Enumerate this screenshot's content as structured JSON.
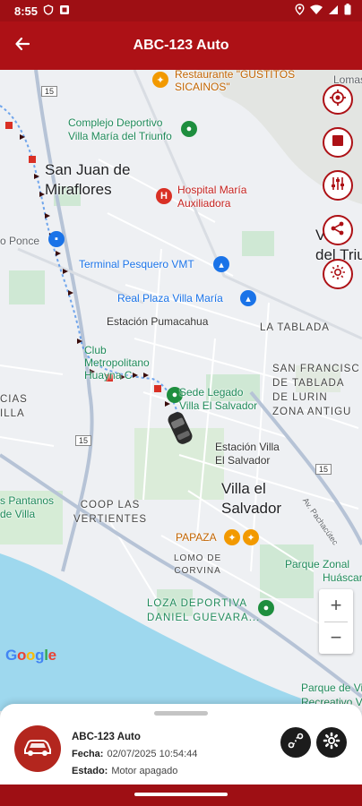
{
  "status_bar": {
    "time": "8:55"
  },
  "app_bar": {
    "title": "ABC-123 Auto"
  },
  "map": {
    "labels": {
      "restaurante_gustitos": "Restaurante \"GUSTITOS SICAINOS\"",
      "lomas": "Lomas",
      "complejo_deportivo": "Complejo Deportivo Villa María del Triunfo",
      "san_juan": "San Juan de Miraflores",
      "hospital": "Hospital María Auxiliadora",
      "villa_maria_triunfo_1": "V",
      "villa_maria_triunfo_2": "M",
      "villa_maria_triunfo_3": "del Triu",
      "ponce": "o Ponce",
      "terminal": "Terminal Pesquero VMT",
      "real_plaza": "Real Plaza Villa María",
      "estacion_pumacahua": "Estación Pumacahua",
      "la_tablada": "LA TABLADA",
      "club_1": "Club",
      "club_2": "Metropolitano",
      "club_3": "Huayna C",
      "san_francisco_1": "SAN FRANCISC",
      "san_francisco_2": "DE TABLADA",
      "san_francisco_3": "DE LURIN",
      "zona_antigua": "ZONA ANTIGU",
      "cias": "CIAS",
      "illa": "ILLA",
      "sede_legado_1": "Sede Legado",
      "sede_legado_2": "Villa El Salvador",
      "estacion_ves_1": "Estación Villa",
      "estacion_ves_2": "El Salvador",
      "villa_salvador_1": "Villa el",
      "villa_salvador_2": "Salvador",
      "pantanos_1": "s Pantanos",
      "pantanos_2": "de Villa",
      "coop_1": "COOP LAS",
      "coop_2": "VERTIENTES",
      "papaza": "PAPAZA",
      "lomo_corvina_1": "LOMO DE",
      "lomo_corvina_2": "CORVINA",
      "parque_zonal_1": "Parque Zonal",
      "parque_zonal_2": "Huáscar",
      "loza_1": "LOZA DEPORTIVA",
      "loza_2": "DANIEL GUEVARA...",
      "parque_villa_1": "Parque de Villa",
      "parque_villa_2": "Recreativo Villa",
      "av_pachacutec": "Av. Pachacútec",
      "route_15_a": "15",
      "route_15_b": "15",
      "route_15_c": "15",
      "google": "Google"
    },
    "zoom": {
      "in": "+",
      "out": "−"
    }
  },
  "side_buttons": [
    "target-icon",
    "stop-icon",
    "sliders-icon",
    "share-icon",
    "brightness-icon"
  ],
  "vehicle": {
    "name": "ABC-123 Auto",
    "fecha_label": "Fecha:",
    "fecha": "02/07/2025 10:54:44",
    "estado_label": "Estado:",
    "estado": "Motor apagado"
  },
  "colors": {
    "brand": "#ad1116",
    "status_bar": "#9e0f14",
    "route": "#1a73e8",
    "water": "#9ed8ee"
  }
}
